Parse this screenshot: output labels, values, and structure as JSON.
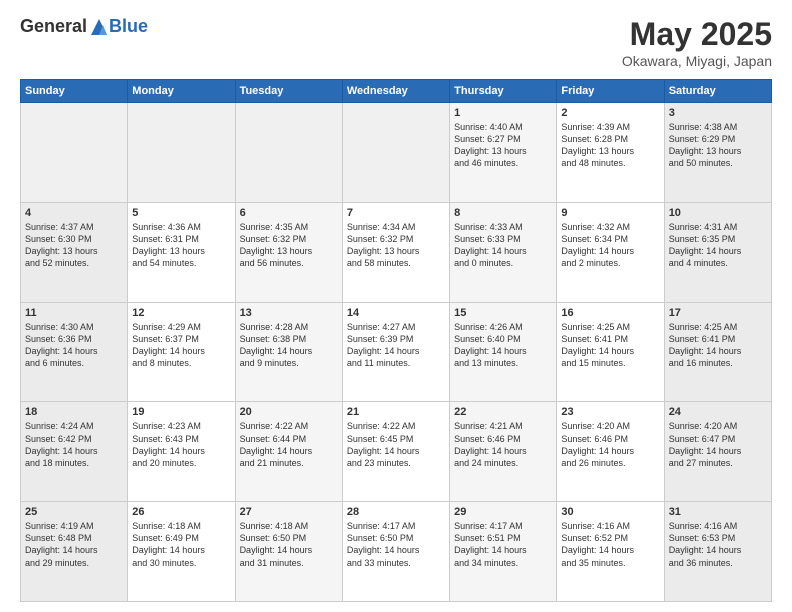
{
  "header": {
    "logo_general": "General",
    "logo_blue": "Blue",
    "month_title": "May 2025",
    "location": "Okawara, Miyagi, Japan"
  },
  "days_of_week": [
    "Sunday",
    "Monday",
    "Tuesday",
    "Wednesday",
    "Thursday",
    "Friday",
    "Saturday"
  ],
  "weeks": [
    [
      {
        "num": "",
        "info": ""
      },
      {
        "num": "",
        "info": ""
      },
      {
        "num": "",
        "info": ""
      },
      {
        "num": "",
        "info": ""
      },
      {
        "num": "1",
        "info": "Sunrise: 4:40 AM\nSunset: 6:27 PM\nDaylight: 13 hours\nand 46 minutes."
      },
      {
        "num": "2",
        "info": "Sunrise: 4:39 AM\nSunset: 6:28 PM\nDaylight: 13 hours\nand 48 minutes."
      },
      {
        "num": "3",
        "info": "Sunrise: 4:38 AM\nSunset: 6:29 PM\nDaylight: 13 hours\nand 50 minutes."
      }
    ],
    [
      {
        "num": "4",
        "info": "Sunrise: 4:37 AM\nSunset: 6:30 PM\nDaylight: 13 hours\nand 52 minutes."
      },
      {
        "num": "5",
        "info": "Sunrise: 4:36 AM\nSunset: 6:31 PM\nDaylight: 13 hours\nand 54 minutes."
      },
      {
        "num": "6",
        "info": "Sunrise: 4:35 AM\nSunset: 6:32 PM\nDaylight: 13 hours\nand 56 minutes."
      },
      {
        "num": "7",
        "info": "Sunrise: 4:34 AM\nSunset: 6:32 PM\nDaylight: 13 hours\nand 58 minutes."
      },
      {
        "num": "8",
        "info": "Sunrise: 4:33 AM\nSunset: 6:33 PM\nDaylight: 14 hours\nand 0 minutes."
      },
      {
        "num": "9",
        "info": "Sunrise: 4:32 AM\nSunset: 6:34 PM\nDaylight: 14 hours\nand 2 minutes."
      },
      {
        "num": "10",
        "info": "Sunrise: 4:31 AM\nSunset: 6:35 PM\nDaylight: 14 hours\nand 4 minutes."
      }
    ],
    [
      {
        "num": "11",
        "info": "Sunrise: 4:30 AM\nSunset: 6:36 PM\nDaylight: 14 hours\nand 6 minutes."
      },
      {
        "num": "12",
        "info": "Sunrise: 4:29 AM\nSunset: 6:37 PM\nDaylight: 14 hours\nand 8 minutes."
      },
      {
        "num": "13",
        "info": "Sunrise: 4:28 AM\nSunset: 6:38 PM\nDaylight: 14 hours\nand 9 minutes."
      },
      {
        "num": "14",
        "info": "Sunrise: 4:27 AM\nSunset: 6:39 PM\nDaylight: 14 hours\nand 11 minutes."
      },
      {
        "num": "15",
        "info": "Sunrise: 4:26 AM\nSunset: 6:40 PM\nDaylight: 14 hours\nand 13 minutes."
      },
      {
        "num": "16",
        "info": "Sunrise: 4:25 AM\nSunset: 6:41 PM\nDaylight: 14 hours\nand 15 minutes."
      },
      {
        "num": "17",
        "info": "Sunrise: 4:25 AM\nSunset: 6:41 PM\nDaylight: 14 hours\nand 16 minutes."
      }
    ],
    [
      {
        "num": "18",
        "info": "Sunrise: 4:24 AM\nSunset: 6:42 PM\nDaylight: 14 hours\nand 18 minutes."
      },
      {
        "num": "19",
        "info": "Sunrise: 4:23 AM\nSunset: 6:43 PM\nDaylight: 14 hours\nand 20 minutes."
      },
      {
        "num": "20",
        "info": "Sunrise: 4:22 AM\nSunset: 6:44 PM\nDaylight: 14 hours\nand 21 minutes."
      },
      {
        "num": "21",
        "info": "Sunrise: 4:22 AM\nSunset: 6:45 PM\nDaylight: 14 hours\nand 23 minutes."
      },
      {
        "num": "22",
        "info": "Sunrise: 4:21 AM\nSunset: 6:46 PM\nDaylight: 14 hours\nand 24 minutes."
      },
      {
        "num": "23",
        "info": "Sunrise: 4:20 AM\nSunset: 6:46 PM\nDaylight: 14 hours\nand 26 minutes."
      },
      {
        "num": "24",
        "info": "Sunrise: 4:20 AM\nSunset: 6:47 PM\nDaylight: 14 hours\nand 27 minutes."
      }
    ],
    [
      {
        "num": "25",
        "info": "Sunrise: 4:19 AM\nSunset: 6:48 PM\nDaylight: 14 hours\nand 29 minutes."
      },
      {
        "num": "26",
        "info": "Sunrise: 4:18 AM\nSunset: 6:49 PM\nDaylight: 14 hours\nand 30 minutes."
      },
      {
        "num": "27",
        "info": "Sunrise: 4:18 AM\nSunset: 6:50 PM\nDaylight: 14 hours\nand 31 minutes."
      },
      {
        "num": "28",
        "info": "Sunrise: 4:17 AM\nSunset: 6:50 PM\nDaylight: 14 hours\nand 33 minutes."
      },
      {
        "num": "29",
        "info": "Sunrise: 4:17 AM\nSunset: 6:51 PM\nDaylight: 14 hours\nand 34 minutes."
      },
      {
        "num": "30",
        "info": "Sunrise: 4:16 AM\nSunset: 6:52 PM\nDaylight: 14 hours\nand 35 minutes."
      },
      {
        "num": "31",
        "info": "Sunrise: 4:16 AM\nSunset: 6:53 PM\nDaylight: 14 hours\nand 36 minutes."
      }
    ]
  ]
}
